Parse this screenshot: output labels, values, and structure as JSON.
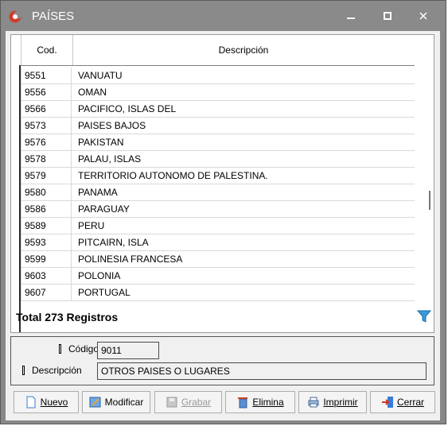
{
  "window": {
    "title": "PAÍSES"
  },
  "grid": {
    "columns": [
      "Cod.",
      "Descripción"
    ],
    "rows": [
      {
        "cod": "9551",
        "desc": "VANUATU"
      },
      {
        "cod": "9556",
        "desc": "OMAN"
      },
      {
        "cod": "9566",
        "desc": "PACIFICO, ISLAS DEL"
      },
      {
        "cod": "9573",
        "desc": "PAISES BAJOS"
      },
      {
        "cod": "9576",
        "desc": "PAKISTAN"
      },
      {
        "cod": "9578",
        "desc": "PALAU, ISLAS"
      },
      {
        "cod": "9579",
        "desc": "TERRITORIO AUTONOMO DE PALESTINA."
      },
      {
        "cod": "9580",
        "desc": "PANAMA"
      },
      {
        "cod": "9586",
        "desc": "PARAGUAY"
      },
      {
        "cod": "9589",
        "desc": "PERU"
      },
      {
        "cod": "9593",
        "desc": "PITCAIRN, ISLA"
      },
      {
        "cod": "9599",
        "desc": "POLINESIA FRANCESA"
      },
      {
        "cod": "9603",
        "desc": "POLONIA"
      },
      {
        "cod": "9607",
        "desc": "PORTUGAL"
      }
    ]
  },
  "summary": {
    "total_label": "Total 273 Registros"
  },
  "details": {
    "codigo_label": "Código",
    "codigo_value": "9011",
    "descripcion_label": "Descripción",
    "descripcion_value": "OTROS PAISES O LUGARES"
  },
  "buttons": {
    "nuevo": "Nuevo",
    "modificar": "Modificar",
    "grabar": "Grabar",
    "elimina": "Elimina",
    "imprimir": "Imprimir",
    "cerrar": "Cerrar"
  },
  "icons": {
    "app": "app-logo-icon",
    "minimize": "minimize-icon",
    "maximize": "maximize-icon",
    "close": "close-icon",
    "filter": "filter-icon"
  },
  "colors": {
    "titlebar": "#8a8a8a",
    "accent_red": "#d23a2a",
    "filter_blue": "#3a9ad9"
  }
}
